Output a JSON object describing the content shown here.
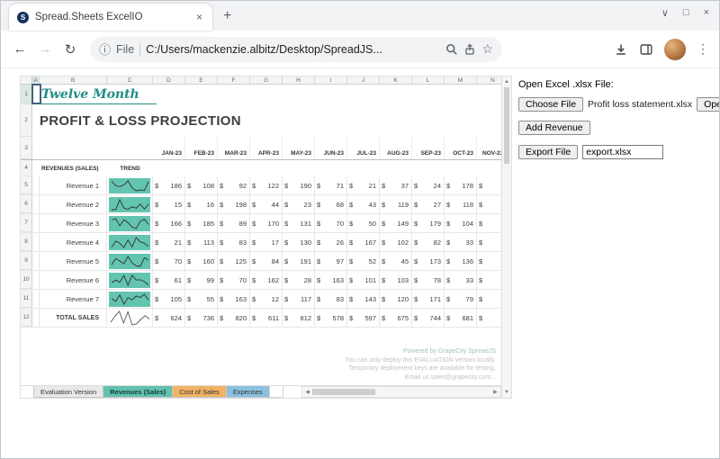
{
  "window": {
    "tab_title": "Spread.Sheets ExcelIO",
    "favicon_letter": "S",
    "new_tab": "+",
    "tab_close": "×",
    "controls": {
      "minimize": "∨",
      "maximize": "□",
      "close": "×"
    }
  },
  "browser": {
    "back": "←",
    "forward": "→",
    "reload": "↻",
    "info_icon": "ⓘ",
    "scheme_label": "File",
    "url": "C:/Users/mackenzie.albitz/Desktop/SpreadJS...",
    "bookmark_star": "☆",
    "menu": "⋮"
  },
  "panel": {
    "open_file_label": "Open Excel .xlsx File:",
    "choose_file_button": "Choose File",
    "chosen_file_name": "Profit loss statement.xlsx",
    "open_button": "Open",
    "add_revenue_button": "Add Revenue",
    "export_file_button": "Export File",
    "export_file_value": "export.xlsx"
  },
  "sheet": {
    "col_letters": [
      "A",
      "B",
      "C",
      "D",
      "E",
      "F",
      "G",
      "H",
      "I",
      "J",
      "K",
      "L",
      "M",
      "N"
    ],
    "title_script": "Twelve Month",
    "title_main": "PROFIT & LOSS PROJECTION",
    "months": [
      "JAN-23",
      "FEB-23",
      "MAR-23",
      "APR-23",
      "MAY-23",
      "JUN-23",
      "JUL-23",
      "AUG-23",
      "SEP-23",
      "OCT-23",
      "NOV-23"
    ],
    "revenues_header": "REVENUES (SALES)",
    "trend_header": "TREND",
    "currency_symbol": "$",
    "rows": [
      {
        "label": "Revenue 1",
        "values": [
          186,
          108,
          92,
          122,
          190,
          71,
          21,
          37,
          24,
          178
        ]
      },
      {
        "label": "Revenue 2",
        "values": [
          15,
          16,
          198,
          44,
          23,
          68,
          43,
          119,
          27,
          118
        ]
      },
      {
        "label": "Revenue 3",
        "values": [
          166,
          185,
          89,
          170,
          131,
          70,
          50,
          149,
          179,
          104
        ]
      },
      {
        "label": "Revenue 4",
        "values": [
          21,
          113,
          83,
          17,
          130,
          26,
          167,
          102,
          82,
          33
        ]
      },
      {
        "label": "Revenue 5",
        "values": [
          70,
          160,
          125,
          84,
          191,
          97,
          52,
          45,
          173,
          136
        ]
      },
      {
        "label": "Revenue 6",
        "values": [
          61,
          99,
          70,
          162,
          28,
          163,
          101,
          103,
          78,
          33
        ]
      },
      {
        "label": "Revenue 7",
        "values": [
          105,
          55,
          163,
          12,
          117,
          83,
          143,
          120,
          171,
          79
        ]
      }
    ],
    "total_row": {
      "label": "TOTAL SALES",
      "values": [
        624,
        736,
        820,
        611,
        812,
        578,
        597,
        675,
        744,
        681
      ]
    },
    "footer_lines": [
      "Powered by GrapeCity SpreadJS",
      "You can only deploy this EVALUATION version locally.",
      "Temporary deployment keys are available for testing.",
      "Email us.sales@grapecity.com..."
    ],
    "tabs": [
      {
        "label": "Evaluation Version",
        "color": "#e9e9e9",
        "active": false
      },
      {
        "label": "Revenues (Sales)",
        "color": "#63c1ae",
        "active": true
      },
      {
        "label": "Cost of Sales",
        "color": "#f2b263",
        "active": false
      },
      {
        "label": "Expenses",
        "color": "#8bc0e0",
        "active": false
      }
    ]
  }
}
